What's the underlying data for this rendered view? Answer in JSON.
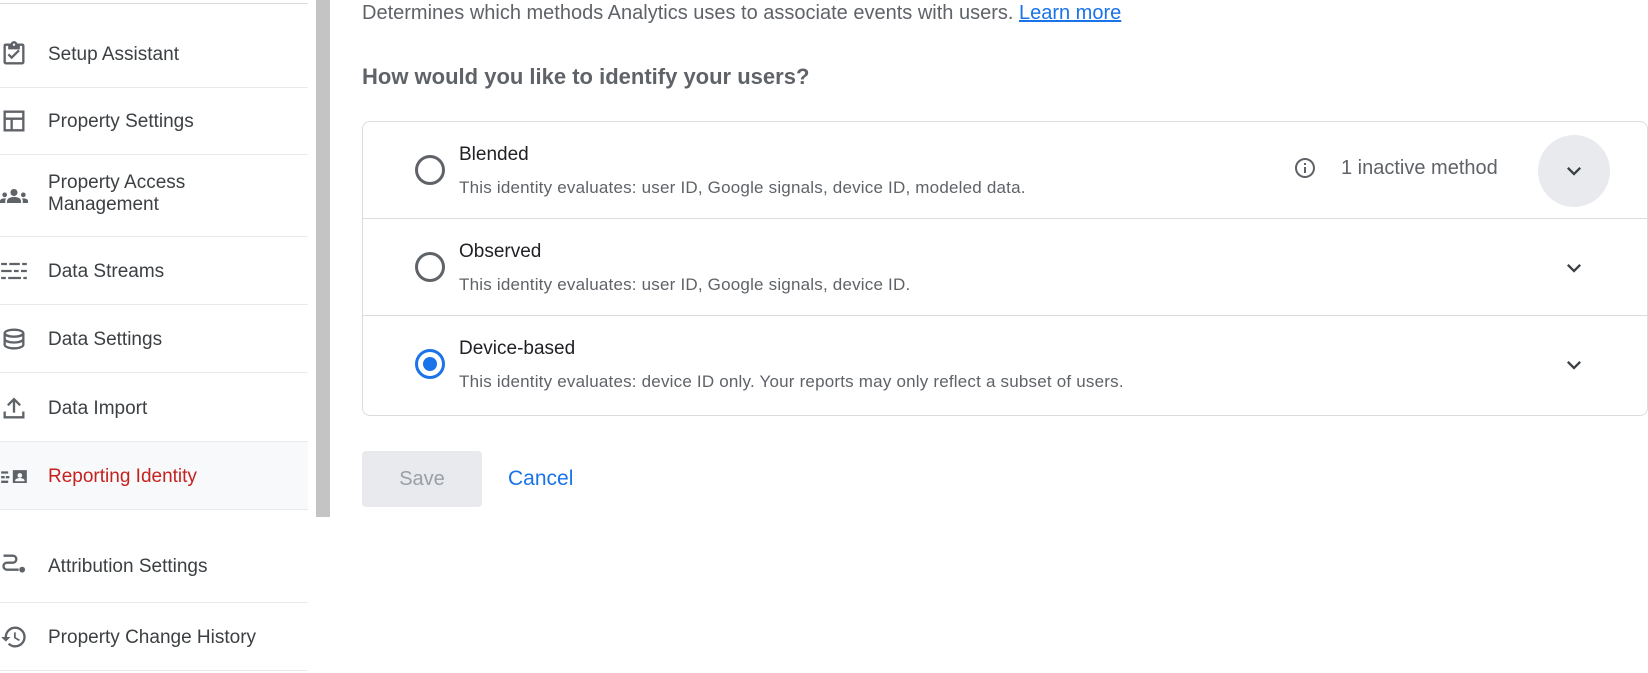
{
  "sidebar": {
    "items": [
      {
        "label": "Setup Assistant",
        "icon": "checklist-icon"
      },
      {
        "label": "Property Settings",
        "icon": "layout-icon"
      },
      {
        "label": "Property Access",
        "label2": "Management",
        "icon": "people-icon"
      },
      {
        "label": "Data Streams",
        "icon": "streams-icon"
      },
      {
        "label": "Data Settings",
        "icon": "database-icon"
      },
      {
        "label": "Data Import",
        "icon": "upload-icon"
      },
      {
        "label": "Reporting Identity",
        "icon": "identity-icon",
        "active": true
      },
      {
        "label": "Attribution Settings",
        "icon": "route-icon"
      },
      {
        "label": "Property Change History",
        "icon": "history-icon"
      }
    ]
  },
  "main": {
    "description": "Determines which methods Analytics uses to associate events with users.",
    "learn_more": "Learn more",
    "question": "How would you like to identify your users?",
    "options": [
      {
        "title": "Blended",
        "subtitle": "This identity evaluates: user ID, Google signals, device ID, modeled data.",
        "selected": false,
        "inactive_note": "1 inactive method"
      },
      {
        "title": "Observed",
        "subtitle": "This identity evaluates: user ID, Google signals, device ID.",
        "selected": false
      },
      {
        "title": "Device-based",
        "subtitle": "This identity evaluates: device ID only. Your reports may only reflect a subset of users.",
        "selected": true
      }
    ],
    "save_label": "Save",
    "cancel_label": "Cancel"
  },
  "colors": {
    "accent": "#1a73e8",
    "active_nav": "#c5221f"
  }
}
